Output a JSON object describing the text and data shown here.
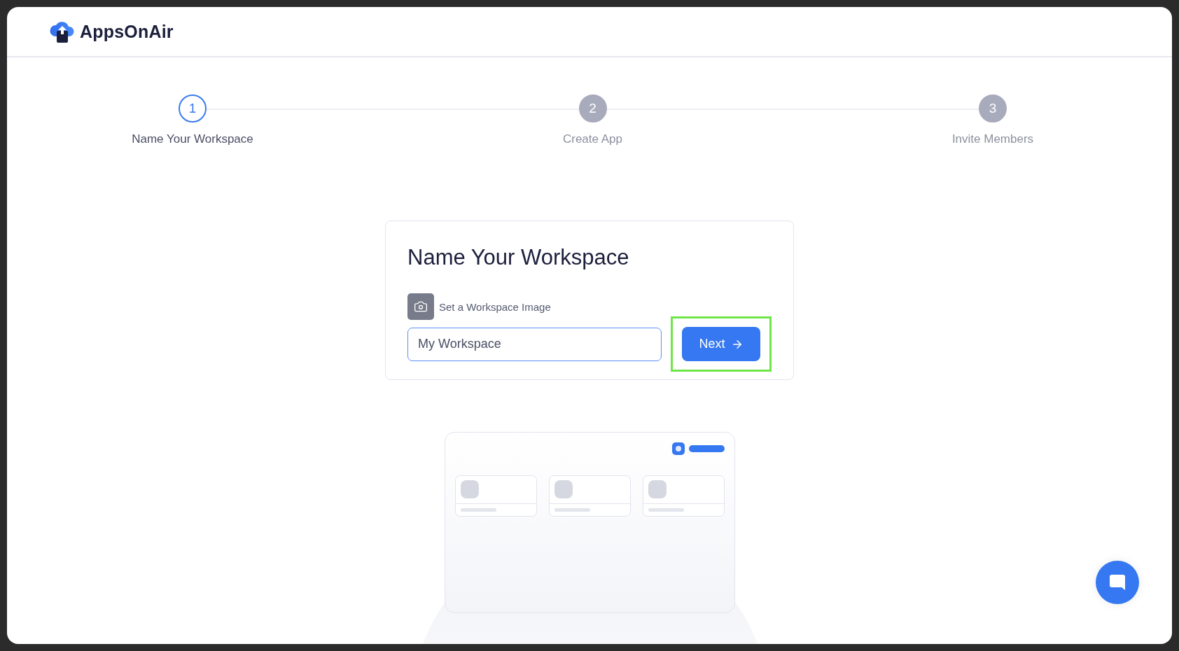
{
  "header": {
    "brand": "AppsOnAir"
  },
  "steps": [
    {
      "number": "1",
      "label": "Name Your Workspace",
      "selected": true
    },
    {
      "number": "2",
      "label": "Create App",
      "selected": false
    },
    {
      "number": "3",
      "label": "Invite Members",
      "selected": false
    }
  ],
  "card": {
    "title": "Name Your Workspace",
    "image_label": "Set a Workspace Image",
    "input": {
      "value": "My Workspace",
      "focused": true
    },
    "next_button": {
      "label": "Next",
      "highlighted": true
    }
  }
}
